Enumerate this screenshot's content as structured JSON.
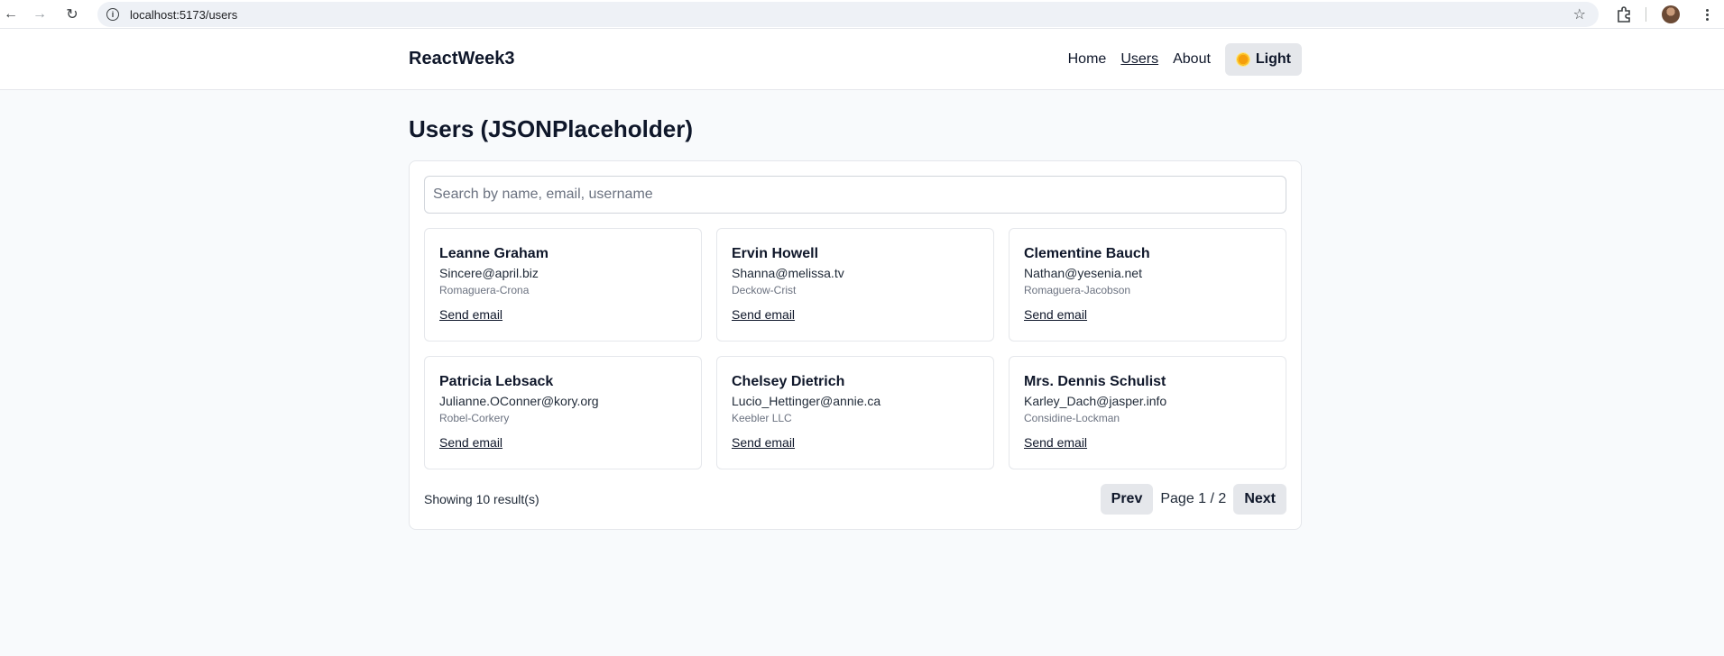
{
  "browser": {
    "url": "localhost:5173/users"
  },
  "header": {
    "brand": "ReactWeek3",
    "nav": [
      "Home",
      "Users",
      "About"
    ],
    "theme_label": "Light"
  },
  "page": {
    "title": "Users (JSONPlaceholder)",
    "search_placeholder": "Search by name, email, username",
    "send_label": "Send email",
    "users": [
      {
        "name": "Leanne Graham",
        "email": "Sincere@april.biz",
        "company": "Romaguera-Crona"
      },
      {
        "name": "Ervin Howell",
        "email": "Shanna@melissa.tv",
        "company": "Deckow-Crist"
      },
      {
        "name": "Clementine Bauch",
        "email": "Nathan@yesenia.net",
        "company": "Romaguera-Jacobson"
      },
      {
        "name": "Patricia Lebsack",
        "email": "Julianne.OConner@kory.org",
        "company": "Robel-Corkery"
      },
      {
        "name": "Chelsey Dietrich",
        "email": "Lucio_Hettinger@annie.ca",
        "company": "Keebler LLC"
      },
      {
        "name": "Mrs. Dennis Schulist",
        "email": "Karley_Dach@jasper.info",
        "company": "Considine-Lockman"
      }
    ],
    "results_text": "Showing 10 result(s)",
    "prev_label": "Prev",
    "page_indicator": "Page 1 / 2",
    "next_label": "Next"
  },
  "colors": {
    "background": "#f8fafc",
    "button_bg": "#e5e7eb",
    "text": "#0f172a"
  }
}
